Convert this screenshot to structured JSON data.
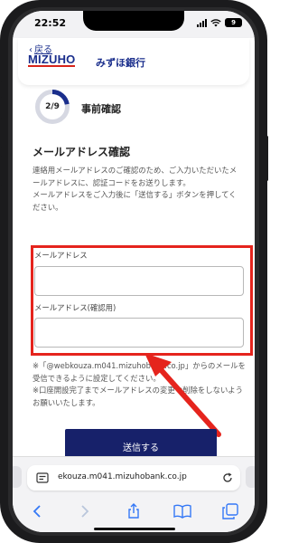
{
  "status_bar": {
    "time": "22:52",
    "battery": "9"
  },
  "header": {
    "back_label": "戻る",
    "logo": "MIZUHO",
    "bank_name": "みずほ銀行"
  },
  "progress": {
    "step_label": "2/9",
    "current_step": 2,
    "total_steps": 9,
    "title": "事前確認"
  },
  "email_section": {
    "title": "メールアドレス確認",
    "description_1": "連絡用メールアドレスのご確認のため、ご入力いただいたメールアドレスに、認証コードをお送りします。",
    "description_2": "メールアドレスをご入力後に「送信する」ボタンを押してください。",
    "email_label": "メールアドレス",
    "email_value": "",
    "email_confirm_label": "メールアドレス(確認用)",
    "email_confirm_value": "",
    "note_1": "※「@webkouza.m041.mizuhobank.co.jp」からのメールを受信できるように設定してください。",
    "note_2": "※口座開設完了までメールアドレスの変更や削除をしないようお願いいたします。",
    "send_button": "送信する"
  },
  "browser": {
    "url": "ekouza.m041.mizuhobank.co.jp"
  },
  "colors": {
    "brand_navy": "#1a2e8c",
    "button_navy": "#17216a",
    "highlight_red": "#e5241d",
    "logo_underline": "#d7241a"
  },
  "icons": [
    "chevron-left-icon",
    "signal-icon",
    "wifi-icon",
    "battery-icon",
    "page-menu-icon",
    "reload-icon",
    "back-icon",
    "forward-icon",
    "share-icon",
    "bookmarks-icon",
    "tabs-icon",
    "arrow-annotation"
  ]
}
